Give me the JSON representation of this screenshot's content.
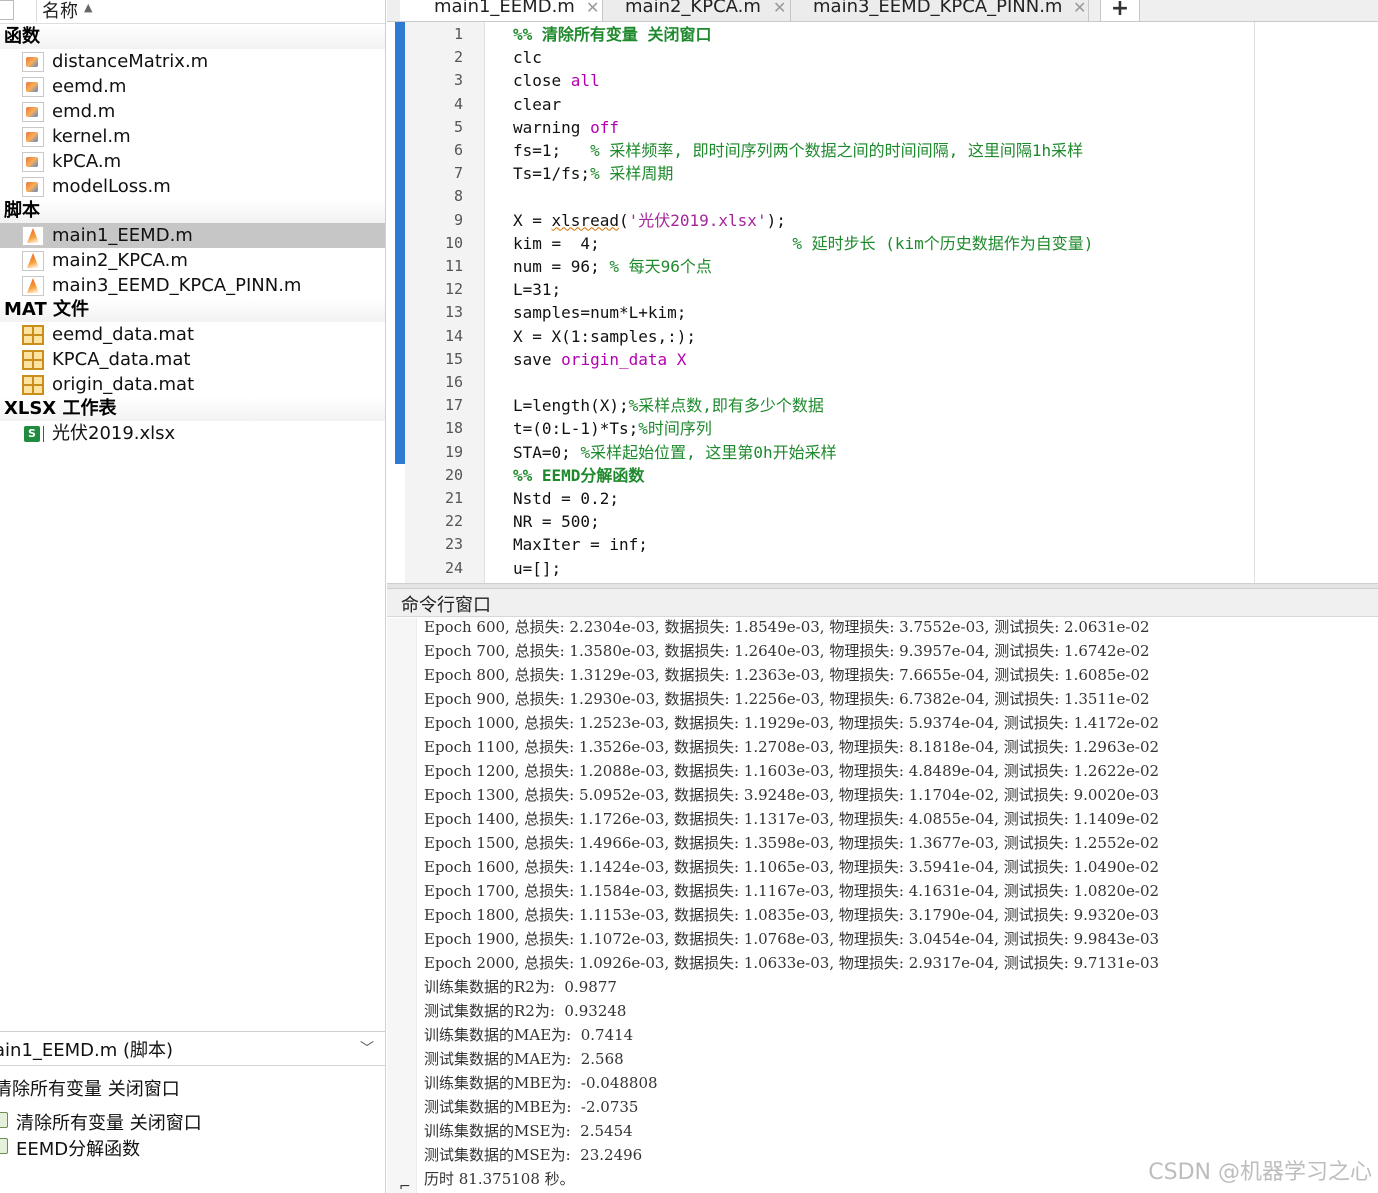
{
  "file_browser": {
    "column_header": "名称",
    "sort_icon": "sort-ascending-icon",
    "sections": [
      {
        "label": "函数",
        "files": [
          "distanceMatrix.m",
          "eemd.m",
          "emd.m",
          "kernel.m",
          "kPCA.m",
          "modelLoss.m"
        ]
      },
      {
        "label": "脚本",
        "files": [
          "main1_EEMD.m",
          "main2_KPCA.m",
          "main3_EEMD_KPCA_PINN.m"
        ]
      },
      {
        "label": "MAT 文件",
        "files": [
          "eemd_data.mat",
          "KPCA_data.mat",
          "origin_data.mat"
        ]
      },
      {
        "label": "XLSX 工作表",
        "files": [
          "光伏2019.xlsx"
        ]
      }
    ],
    "selected_file": "main1_EEMD.m"
  },
  "details": {
    "title": "ain1_EEMD.m  (脚本)",
    "heading": "清除所有变量 关闭窗口",
    "sections": [
      "清除所有变量 关闭窗口",
      "EEMD分解函数"
    ]
  },
  "tabs": [
    {
      "label": "main1_EEMD.m"
    },
    {
      "label": "main2_KPCA.m"
    },
    {
      "label": "main3_EEMD_KPCA_PINN.m"
    }
  ],
  "add_tab_label": "+",
  "editor": {
    "line_numbers": [
      "1",
      "2",
      "3",
      "4",
      "5",
      "6",
      "7",
      "8",
      "9",
      "10",
      "11",
      "12",
      "13",
      "14",
      "15",
      "16",
      "17",
      "18",
      "19",
      "20",
      "21",
      "22",
      "23",
      "24"
    ],
    "lines": [
      [
        {
          "t": "%% 清除所有变量 关闭窗口",
          "c": "cb"
        }
      ],
      [
        {
          "t": "clc",
          "c": ""
        }
      ],
      [
        {
          "t": "close ",
          "c": ""
        },
        {
          "t": "all",
          "c": "k"
        }
      ],
      [
        {
          "t": "clear",
          "c": ""
        }
      ],
      [
        {
          "t": "warning ",
          "c": ""
        },
        {
          "t": "off",
          "c": "k"
        }
      ],
      [
        {
          "t": "fs=1;   ",
          "c": ""
        },
        {
          "t": "% 采样频率, 即时间序列两个数据之间的时间间隔, 这里间隔1h采样",
          "c": "c"
        }
      ],
      [
        {
          "t": "Ts=1/fs;",
          "c": ""
        },
        {
          "t": "% 采样周期",
          "c": "c"
        }
      ],
      [
        {
          "t": "",
          "c": ""
        }
      ],
      [
        {
          "t": "X = ",
          "c": ""
        },
        {
          "t": "xlsread",
          "c": "u"
        },
        {
          "t": "(",
          "c": ""
        },
        {
          "t": "'光伏2019.xlsx'",
          "c": "s"
        },
        {
          "t": ");",
          "c": ""
        }
      ],
      [
        {
          "t": "kim =  4;                    ",
          "c": ""
        },
        {
          "t": "% 延时步长 (kim个历史数据作为自变量)",
          "c": "c"
        }
      ],
      [
        {
          "t": "num = 96; ",
          "c": ""
        },
        {
          "t": "% 每天96个点",
          "c": "c"
        }
      ],
      [
        {
          "t": "L=31;",
          "c": ""
        }
      ],
      [
        {
          "t": "samples=num*L+kim;",
          "c": ""
        }
      ],
      [
        {
          "t": "X = X(1:samples,:);",
          "c": ""
        }
      ],
      [
        {
          "t": "save ",
          "c": ""
        },
        {
          "t": "origin_data X",
          "c": "k"
        }
      ],
      [
        {
          "t": "",
          "c": ""
        }
      ],
      [
        {
          "t": "L=length(X);",
          "c": ""
        },
        {
          "t": "%采样点数,即有多少个数据",
          "c": "c"
        }
      ],
      [
        {
          "t": "t=(0:L-1)*Ts;",
          "c": ""
        },
        {
          "t": "%时间序列",
          "c": "c"
        }
      ],
      [
        {
          "t": "STA=0; ",
          "c": ""
        },
        {
          "t": "%采样起始位置, 这里第0h开始采样",
          "c": "c"
        }
      ],
      [
        {
          "t": "%% EEMD分解函数",
          "c": "cb"
        }
      ],
      [
        {
          "t": "Nstd = 0.2;",
          "c": ""
        }
      ],
      [
        {
          "t": "NR = 500;",
          "c": ""
        }
      ],
      [
        {
          "t": "MaxIter = inf;",
          "c": ""
        }
      ],
      [
        {
          "t": "u=[];",
          "c": ""
        }
      ]
    ]
  },
  "command_window": {
    "title": "命令行窗口",
    "output": [
      "Epoch 600, 总损失: 2.2304e-03, 数据损失: 1.8549e-03, 物理损失: 3.7552e-03, 测试损失: 2.0631e-02",
      "Epoch 700, 总损失: 1.3580e-03, 数据损失: 1.2640e-03, 物理损失: 9.3957e-04, 测试损失: 1.6742e-02",
      "Epoch 800, 总损失: 1.3129e-03, 数据损失: 1.2363e-03, 物理损失: 7.6655e-04, 测试损失: 1.6085e-02",
      "Epoch 900, 总损失: 1.2930e-03, 数据损失: 1.2256e-03, 物理损失: 6.7382e-04, 测试损失: 1.3511e-02",
      "Epoch 1000, 总损失: 1.2523e-03, 数据损失: 1.1929e-03, 物理损失: 5.9374e-04, 测试损失: 1.4172e-02",
      "Epoch 1100, 总损失: 1.3526e-03, 数据损失: 1.2708e-03, 物理损失: 8.1818e-04, 测试损失: 1.2963e-02",
      "Epoch 1200, 总损失: 1.2088e-03, 数据损失: 1.1603e-03, 物理损失: 4.8489e-04, 测试损失: 1.2622e-02",
      "Epoch 1300, 总损失: 5.0952e-03, 数据损失: 3.9248e-03, 物理损失: 1.1704e-02, 测试损失: 9.0020e-03",
      "Epoch 1400, 总损失: 1.1726e-03, 数据损失: 1.1317e-03, 物理损失: 4.0855e-04, 测试损失: 1.1409e-02",
      "Epoch 1500, 总损失: 1.4966e-03, 数据损失: 1.3598e-03, 物理损失: 1.3677e-03, 测试损失: 1.2552e-02",
      "Epoch 1600, 总损失: 1.1424e-03, 数据损失: 1.1065e-03, 物理损失: 3.5941e-04, 测试损失: 1.0490e-02",
      "Epoch 1700, 总损失: 1.1584e-03, 数据损失: 1.1167e-03, 物理损失: 4.1631e-04, 测试损失: 1.0820e-02",
      "Epoch 1800, 总损失: 1.1153e-03, 数据损失: 1.0835e-03, 物理损失: 3.1790e-04, 测试损失: 9.9320e-03",
      "Epoch 1900, 总损失: 1.1072e-03, 数据损失: 1.0768e-03, 物理损失: 3.0454e-04, 测试损失: 9.9843e-03",
      "Epoch 2000, 总损失: 1.0926e-03, 数据损失: 1.0633e-03, 物理损失: 2.9317e-04, 测试损失: 9.7131e-03",
      "训练集数据的R2为:  0.9877",
      "测试集数据的R2为:  0.93248",
      "训练集数据的MAE为:  0.7414",
      "测试集数据的MAE为:  2.568",
      "训练集数据的MBE为:  -0.048808",
      "测试集数据的MBE为:  -2.0735",
      "训练集数据的MSE为:  2.5454",
      "测试集数据的MSE为:  23.2496",
      "历时 81.375108 秒。"
    ]
  },
  "watermark": "CSDN @机器学习之心",
  "colors": {
    "comment": "#1f8a2d",
    "string": "#a3269a",
    "keyword": "#b200b2",
    "selection": "#c6c6c6",
    "gutter_accent": "#2d7bd3"
  }
}
